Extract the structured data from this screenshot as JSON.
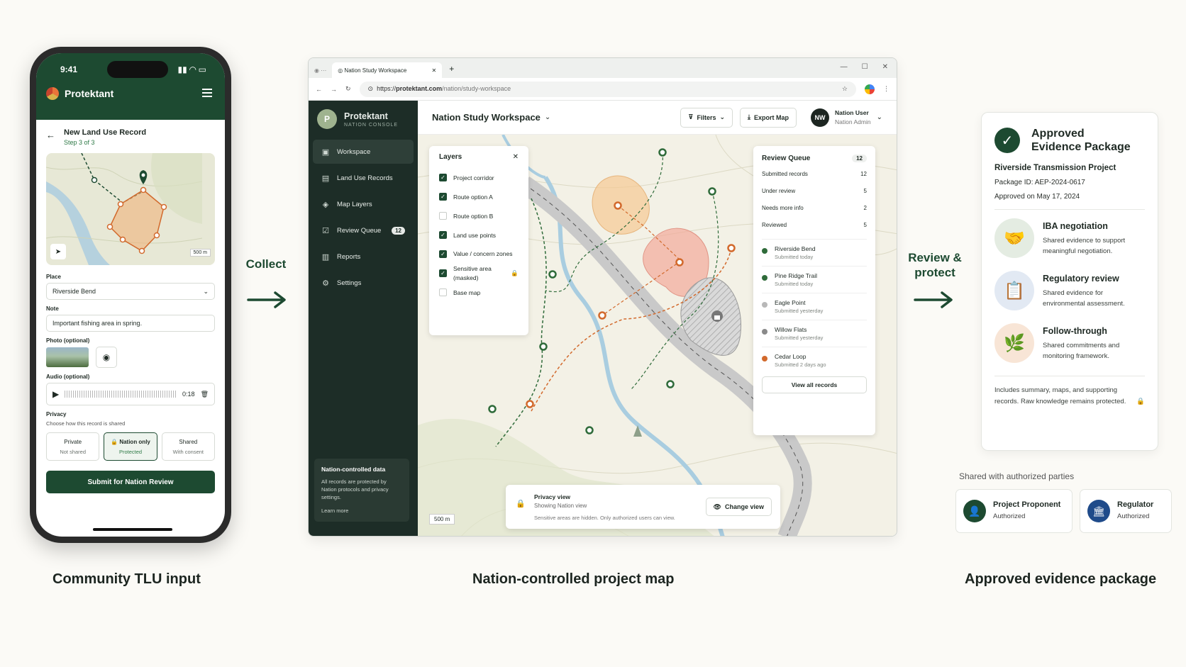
{
  "phone": {
    "time": "9:41",
    "brand": "Protektant",
    "title": "New Land Use Record",
    "step": "Step 3 of 3",
    "map_scale": "500 m",
    "place_label": "Place",
    "place_value": "Riverside Bend",
    "note_label": "Note",
    "note_value": "Important fishing area in spring.",
    "photo_label": "Photo (optional)",
    "audio_label": "Audio (optional)",
    "audio_time": "0:18",
    "privacy_label": "Privacy",
    "privacy_hint": "Choose how this record is shared",
    "options": [
      {
        "title": "Private",
        "sub": "Not shared"
      },
      {
        "title": "Nation only",
        "sub": "Protected"
      },
      {
        "title": "Shared",
        "sub": "With consent"
      }
    ],
    "submit": "Submit for Nation Review"
  },
  "flow": {
    "collect": "Collect",
    "review_line1": "Review &",
    "review_line2": "protect"
  },
  "browser": {
    "tab_title": "Nation Study Workspace",
    "url_prefix": "https://",
    "url_host": "protektant.com",
    "url_path": "/nation/study-workspace",
    "brand": "Protektant",
    "brand_sub": "NATION CONSOLE",
    "brand_initial": "P",
    "nav": [
      {
        "label": "Workspace",
        "icon": "workspace-icon"
      },
      {
        "label": "Land Use Records",
        "icon": "records-icon"
      },
      {
        "label": "Map Layers",
        "icon": "layers-icon"
      },
      {
        "label": "Review Queue",
        "icon": "queue-icon",
        "badge": "12"
      },
      {
        "label": "Reports",
        "icon": "reports-icon"
      },
      {
        "label": "Settings",
        "icon": "gear-icon"
      }
    ],
    "note_title": "Nation-controlled data",
    "note_body": "All records are protected by Nation protocols and privacy settings.",
    "note_link": "Learn more",
    "workspace_title": "Nation Study Workspace",
    "filters": "Filters",
    "export": "Export Map",
    "user_initials": "NW",
    "user_name": "Nation User",
    "user_role": "Nation Admin",
    "layers_title": "Layers",
    "layers": [
      {
        "label": "Project corridor",
        "on": true
      },
      {
        "label": "Route option A",
        "on": true
      },
      {
        "label": "Route option B",
        "on": false
      },
      {
        "label": "Land use points",
        "on": true
      },
      {
        "label": "Value / concern zones",
        "on": true
      },
      {
        "label": "Sensitive area (masked)",
        "on": true
      },
      {
        "label": "Base map",
        "on": false
      }
    ],
    "queue_title": "Review Queue",
    "queue_count": "12",
    "queue_stats": [
      {
        "label": "Submitted records",
        "value": "12"
      },
      {
        "label": "Under review",
        "value": "5"
      },
      {
        "label": "Needs more info",
        "value": "2"
      },
      {
        "label": "Reviewed",
        "value": "5"
      }
    ],
    "queue_items": [
      {
        "name": "Riverside Bend",
        "when": "Submitted today",
        "color": "#2f6b3a"
      },
      {
        "name": "Pine Ridge Trail",
        "when": "Submitted today",
        "color": "#2f6b3a"
      },
      {
        "name": "Eagle Point",
        "when": "Submitted yesterday",
        "color": "#b8b8b8"
      },
      {
        "name": "Willow Flats",
        "when": "Submitted yesterday",
        "color": "#8a8a8a"
      },
      {
        "name": "Cedar Loop",
        "when": "Submitted 2 days ago",
        "color": "#d2692c"
      }
    ],
    "queue_button": "View all records",
    "privacy_title": "Privacy view",
    "privacy_sub": "Showing Nation view",
    "privacy_note": "Sensitive areas are hidden. Only authorized users can view.",
    "change_view": "Change view",
    "map_scale": "500 m"
  },
  "evidence": {
    "title_line1": "Approved",
    "title_line2": "Evidence Package",
    "project": "Riverside Transmission Project",
    "package_id": "Package ID: AEP-2024-0617",
    "approved_on": "Approved on May 17, 2024",
    "items": [
      {
        "title": "IBA negotiation",
        "desc": "Shared evidence to support meaningful negotiation."
      },
      {
        "title": "Regulatory review",
        "desc": "Shared evidence for environmental assessment."
      },
      {
        "title": "Follow-through",
        "desc": "Shared commitments and monitoring framework."
      }
    ],
    "footer": "Includes summary, maps, and supporting records. Raw knowledge remains protected.",
    "shared_label": "Shared with authorized parties",
    "parties": [
      {
        "name": "Project Proponent",
        "status": "Authorized"
      },
      {
        "name": "Regulator",
        "status": "Authorized"
      }
    ]
  },
  "captions": {
    "left": "Community TLU input",
    "middle": "Nation-controlled project map",
    "right": "Approved evidence package"
  }
}
